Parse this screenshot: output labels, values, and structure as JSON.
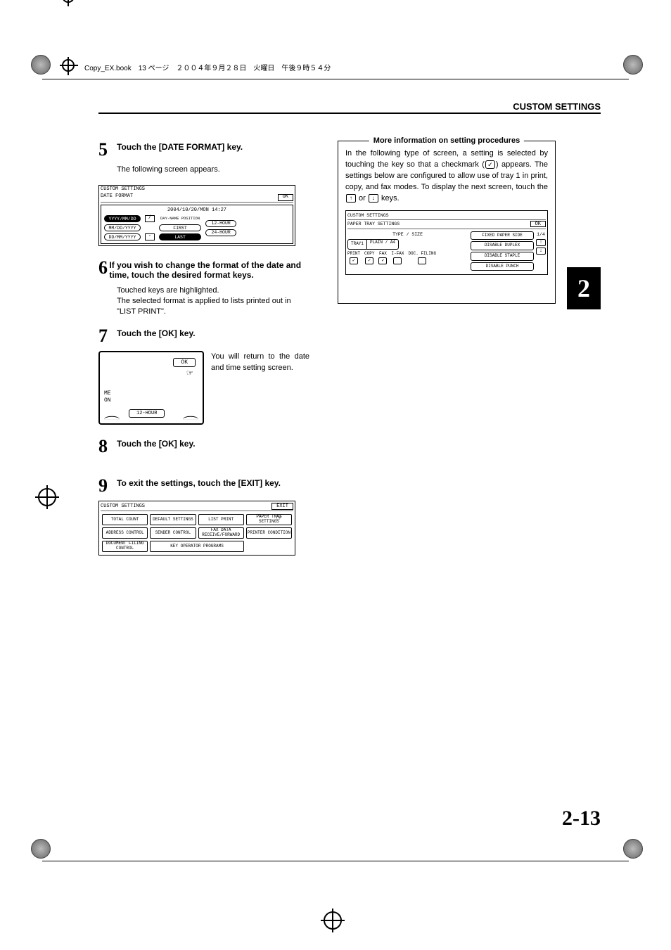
{
  "header": {
    "section_title": "CUSTOM SETTINGS",
    "top_mark_text": "Copy_EX.book　13 ページ　２００４年９月２８日　火曜日　午後９時５４分"
  },
  "steps": {
    "s5": {
      "num": "5",
      "title": "Touch the [DATE FORMAT] key.",
      "body": "The following screen appears."
    },
    "s6": {
      "num": "6",
      "title": "If you wish to change the format of the date and time, touch the desired format keys.",
      "body1": "Touched keys are highlighted.",
      "body2": "The selected format is applied to lists printed out in \"LIST PRINT\"."
    },
    "s7": {
      "num": "7",
      "title": "Touch the [OK] key.",
      "side_text": "You will return to the date and time setting screen."
    },
    "s8": {
      "num": "8",
      "title": "Touch the [OK] key."
    },
    "s9": {
      "num": "9",
      "title": "To exit the settings, touch the [EXIT] key."
    }
  },
  "screen5": {
    "hdr": "CUSTOM SETTINGS",
    "sub": "DATE FORMAT",
    "ok": "OK",
    "timestamp": "2004/10/20/MON 14:27",
    "fmt1": "YYYY/MM/DD",
    "fmt2": "MM/DD/YYYY",
    "fmt3": "DD/MM/YYYY",
    "slash": "/",
    "dash": "-",
    "dayname": "DAY-NAME POSITION",
    "first": "FIRST",
    "last": "LAST",
    "h12": "12-HOUR",
    "h24": "24-HOUR"
  },
  "screen7": {
    "ok": "OK",
    "me": "ME",
    "on": "ON",
    "hour": "12-HOUR"
  },
  "screen9": {
    "hdr": "CUSTOM SETTINGS",
    "exit": "EXIT",
    "total_count": "TOTAL COUNT",
    "default_settings": "DEFAULT SETTINGS",
    "list_print": "LIST PRINT",
    "paper_tray": "PAPER TRAY SETTINGS",
    "address_control": "ADDRESS CONTROL",
    "sender_control": "SENDER CONTROL",
    "fax_data": "FAX DATA RECEIVE/FORWARD",
    "printer_cond": "PRINTER CONDITION",
    "doc_filing": "DOCUMENT FILING CONTROL",
    "key_op": "KEY OPERATOR PROGRAMS"
  },
  "infobox": {
    "legend": "More information on setting procedures",
    "text_a": "In the following type of screen, a setting is selected by touching the key so that a checkmark (",
    "text_b": ") appears. The settings below are configured to allow use of tray 1 in print, copy, and fax modes. To display the next screen, touch the ",
    "text_or": " or ",
    "text_c": " keys."
  },
  "infoscreen": {
    "hdr": "CUSTOM SETTINGS",
    "sub": "PAPER TRAY SETTINGS",
    "ok": "OK",
    "type_size": "TYPE / SIZE",
    "tray1": "TRAY1",
    "plain": "PLAIN / A4",
    "print": "PRINT",
    "copy": "COPY",
    "fax": "FAX",
    "ifax": "I-FAX",
    "docfiling": "DOC. FILING",
    "fixed": "FIXED PAPER SIDE",
    "duplex": "DISABLE DUPLEX",
    "staple": "DISABLE STAPLE",
    "punch": "DISABLE PUNCH",
    "page": "1/4"
  },
  "side_tab": "2",
  "page_number": "2-13"
}
